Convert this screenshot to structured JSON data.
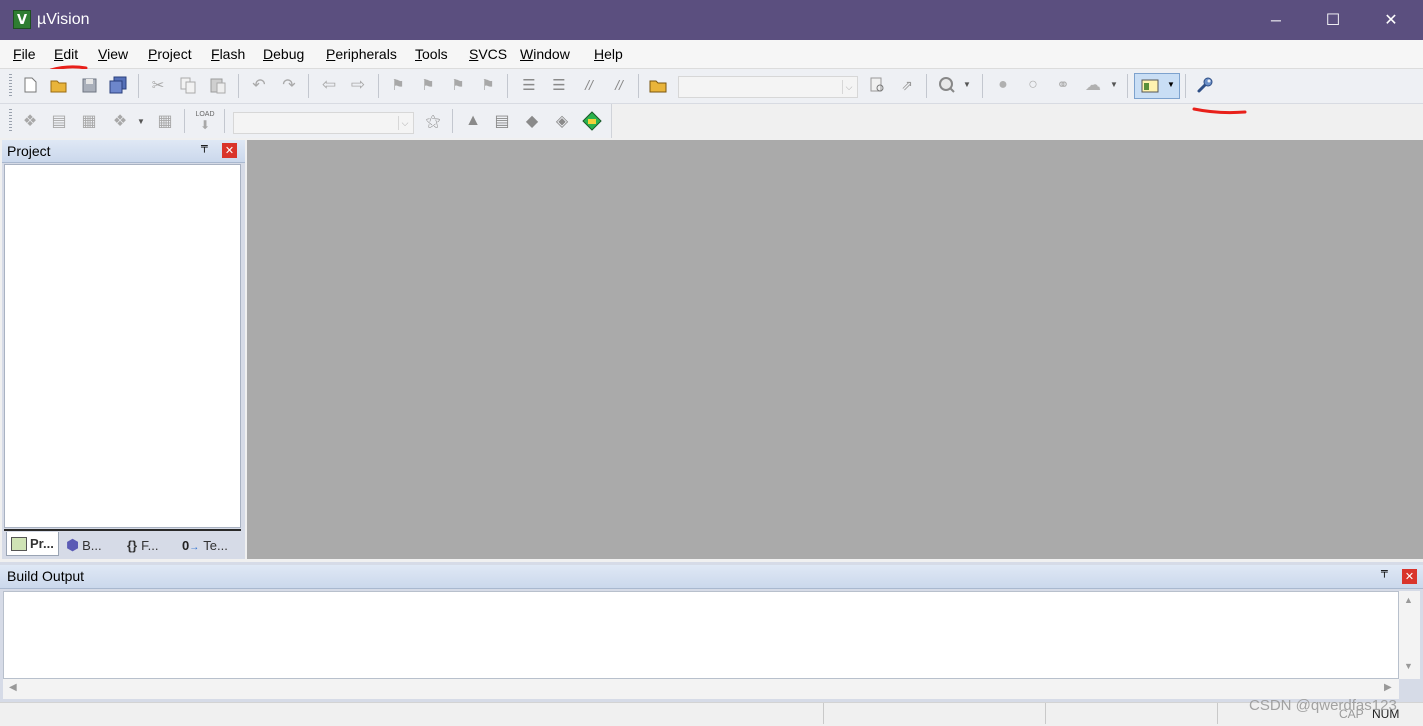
{
  "window": {
    "title": "µVision",
    "icon_glyph": "V"
  },
  "menu": [
    "File",
    "Edit",
    "View",
    "Project",
    "Flash",
    "Debug",
    "Peripherals",
    "Tools",
    "SVCS",
    "Window",
    "Help"
  ],
  "window_controls": {
    "minimize": "─",
    "maximize": "☐",
    "close": "✕"
  },
  "toolbar2": {
    "load_label": "LOAD"
  },
  "project_panel": {
    "title": "Project",
    "tabs": [
      {
        "label": "Pr..."
      },
      {
        "label": "B..."
      },
      {
        "label": "F..."
      },
      {
        "label": "Te..."
      }
    ]
  },
  "build_output": {
    "title": "Build Output"
  },
  "status": {
    "cap": "CAP",
    "num": "NUM"
  },
  "watermark": "CSDN @qwerdfas123",
  "colors": {
    "titlebar": "#5b4f7f",
    "editor_bg": "#aaaaaa",
    "annotation": "#e8201a"
  }
}
